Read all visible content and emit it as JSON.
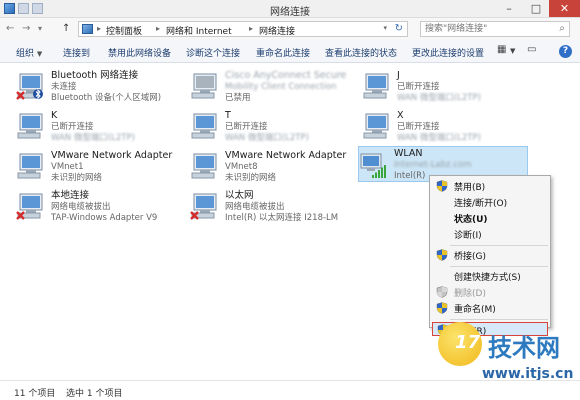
{
  "window": {
    "title": "网络连接",
    "minimize": "–",
    "maximize": "□",
    "close": "✕"
  },
  "nav": {
    "back": "←",
    "forward": "→",
    "down": "▾",
    "up": "↑"
  },
  "address": {
    "crumbs": [
      "控制面板",
      "网络和 Internet",
      "网络连接"
    ],
    "separator": "▸"
  },
  "search": {
    "placeholder": "搜索\"网络连接\""
  },
  "toolbar": {
    "organize": "组织",
    "items": [
      "连接到",
      "禁用此网络设备",
      "诊断这个连接",
      "重命名此连接",
      "查看此连接的状态",
      "更改此连接的设置"
    ],
    "help": "?"
  },
  "connections": [
    {
      "name": "Bluetooth 网络连接",
      "status": "未连接",
      "device": "Bluetooth 设备(个人区域网)",
      "disconnected": true,
      "bluetooth": true
    },
    {
      "name": "Cisco AnyConnect Secure",
      "status": "Mobility Client Connection",
      "device": "已禁用",
      "blurred": true,
      "disabled": true
    },
    {
      "name": "J",
      "status": "已断开连接",
      "device": "WAN 微型端口(L2TP)",
      "blur_device": true
    },
    {
      "name": "K",
      "status": "已断开连接",
      "device": "WAN 微型端口(L2TP)",
      "blur_device": true
    },
    {
      "name": "T",
      "status": "已断开连接",
      "device": "WAN 微型端口(L2TP)",
      "blur_device": true
    },
    {
      "name": "X",
      "status": "已断开连接",
      "device": "WAN 微型端口(L2TP)",
      "blur_device": true
    },
    {
      "name": "VMware Network Adapter",
      "status": "VMnet1",
      "device": "未识别的网络"
    },
    {
      "name": "VMware Network Adapter",
      "status": "VMnet8",
      "device": "未识别的网络"
    },
    {
      "name": "WLAN",
      "status": "Internet-Labz.com",
      "device": "Intel(R)",
      "wifi": true,
      "selected": true,
      "blur_status": true
    },
    {
      "name": "本地连接",
      "status": "网络电缆被拔出",
      "device": "TAP-Windows Adapter V9",
      "disconnected": true
    },
    {
      "name": "以太网",
      "status": "网络电缆被拔出",
      "device": "Intel(R) 以太网连接 I218-LM",
      "disconnected": true
    }
  ],
  "context_menu": [
    {
      "label": "禁用(B)",
      "shield": true
    },
    {
      "label": "连接/断开(O)"
    },
    {
      "label": "状态(U)",
      "bold": true
    },
    {
      "label": "诊断(I)"
    },
    {
      "label": "桥接(G)",
      "shield": true,
      "sep_before": true
    },
    {
      "label": "创建快捷方式(S)",
      "sep_before": true
    },
    {
      "label": "删除(D)",
      "shield": true,
      "disabled": true
    },
    {
      "label": "重命名(M)",
      "shield": true
    },
    {
      "label": "属性(R)",
      "shield": true,
      "highlighted": true,
      "sep_before": true
    }
  ],
  "status": {
    "count": "11 个项目",
    "selected": "选中 1 个项目"
  },
  "watermark": {
    "number": "17",
    "brand": "技术网",
    "url": "www.itjs.cn"
  },
  "colors": {
    "selection": "#cde6f7",
    "accent": "#2f6fc8",
    "highlight_border": "#d9443a"
  }
}
